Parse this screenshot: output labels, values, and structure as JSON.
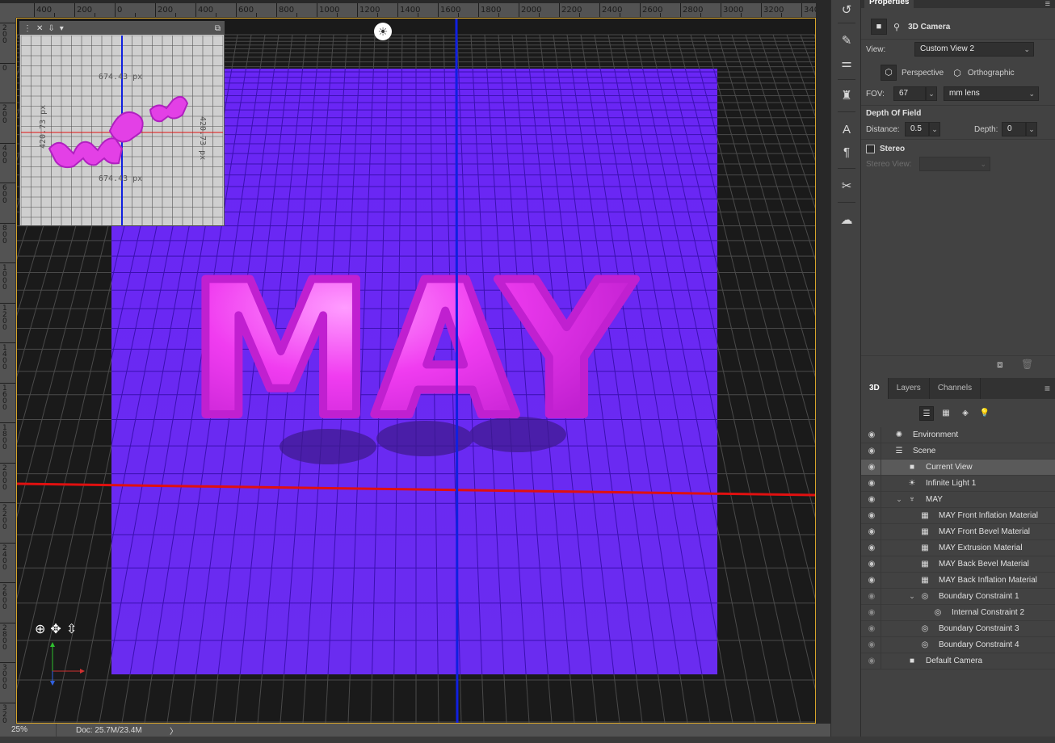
{
  "ruler": {
    "top_labels": [
      "400",
      "200",
      "0",
      "200",
      "400",
      "600",
      "800",
      "1000",
      "1200",
      "1400",
      "1600",
      "1800",
      "2000",
      "2200",
      "2400",
      "2600",
      "2800",
      "3000",
      "3200",
      "340"
    ],
    "left_labels": [
      "2\n0\n0",
      "0",
      "2\n0\n0",
      "4\n0\n0",
      "6\n0\n0",
      "8\n0\n0",
      "1\n0\n0\n0",
      "1\n2\n0\n0",
      "1\n4\n0\n0",
      "1\n6\n0\n0",
      "1\n8\n0\n0",
      "2\n0\n0\n0",
      "2\n2\n0\n0",
      "2\n4\n0\n0",
      "2\n6\n0\n0",
      "2\n8\n0\n0",
      "3\n0\n0\n0",
      "3\n2\n0\n0"
    ]
  },
  "canvas": {
    "text_3d": "MAY",
    "ground_color": "#6a26f5",
    "text_color": "#f03cf0",
    "axis_x_color": "#e01010",
    "axis_y_color": "#1020e0"
  },
  "minimap": {
    "dim_top": "674.43 px",
    "dim_bottom": "674.43 px",
    "dim_left": "420.73 px",
    "dim_right": "420.73 px"
  },
  "status": {
    "zoom": "25%",
    "doc": "Doc: 25.7M/23.4M",
    "arrow": "〉"
  },
  "properties": {
    "tab": "Properties",
    "title": "3D Camera",
    "view_label": "View:",
    "view_value": "Custom View 2",
    "perspective": "Perspective",
    "orthographic": "Orthographic",
    "fov_label": "FOV:",
    "fov_value": "67",
    "lens_value": "mm lens",
    "dof_title": "Depth Of Field",
    "distance_label": "Distance:",
    "distance_value": "0.5",
    "depth_label": "Depth:",
    "depth_value": "0",
    "stereo_label": "Stereo",
    "stereo_view_label": "Stereo View:"
  },
  "panel3d": {
    "tabs": [
      "3D",
      "Layers",
      "Channels"
    ],
    "tree": [
      {
        "name": "Environment",
        "indent": 0,
        "icon": "✺",
        "twisty": "",
        "eye": true,
        "selected": false
      },
      {
        "name": "Scene",
        "indent": 0,
        "icon": "☰",
        "twisty": "",
        "eye": true,
        "selected": false
      },
      {
        "name": "Current View",
        "indent": 1,
        "icon": "■",
        "twisty": "",
        "eye": true,
        "selected": true
      },
      {
        "name": "Infinite Light 1",
        "indent": 1,
        "icon": "☀",
        "twisty": "",
        "eye": true,
        "selected": false
      },
      {
        "name": "MAY",
        "indent": 1,
        "icon": "♆",
        "twisty": "⌄",
        "eye": true,
        "selected": false
      },
      {
        "name": "MAY Front Inflation Material",
        "indent": 2,
        "icon": "▦",
        "twisty": "",
        "eye": true,
        "selected": false
      },
      {
        "name": "MAY Front Bevel Material",
        "indent": 2,
        "icon": "▦",
        "twisty": "",
        "eye": true,
        "selected": false
      },
      {
        "name": "MAY Extrusion Material",
        "indent": 2,
        "icon": "▦",
        "twisty": "",
        "eye": true,
        "selected": false
      },
      {
        "name": "MAY Back Bevel Material",
        "indent": 2,
        "icon": "▦",
        "twisty": "",
        "eye": true,
        "selected": false
      },
      {
        "name": "MAY Back Inflation Material",
        "indent": 2,
        "icon": "▦",
        "twisty": "",
        "eye": true,
        "selected": false
      },
      {
        "name": "Boundary Constraint 1",
        "indent": 2,
        "icon": "◎",
        "twisty": "⌄",
        "eye": false,
        "selected": false
      },
      {
        "name": "Internal Constraint 2",
        "indent": 3,
        "icon": "◎",
        "twisty": "",
        "eye": false,
        "selected": false
      },
      {
        "name": "Boundary Constraint 3",
        "indent": 2,
        "icon": "◎",
        "twisty": "",
        "eye": false,
        "selected": false
      },
      {
        "name": "Boundary Constraint 4",
        "indent": 2,
        "icon": "◎",
        "twisty": "",
        "eye": false,
        "selected": false
      },
      {
        "name": "Default Camera",
        "indent": 1,
        "icon": "■",
        "twisty": "",
        "eye": false,
        "selected": false
      }
    ]
  }
}
